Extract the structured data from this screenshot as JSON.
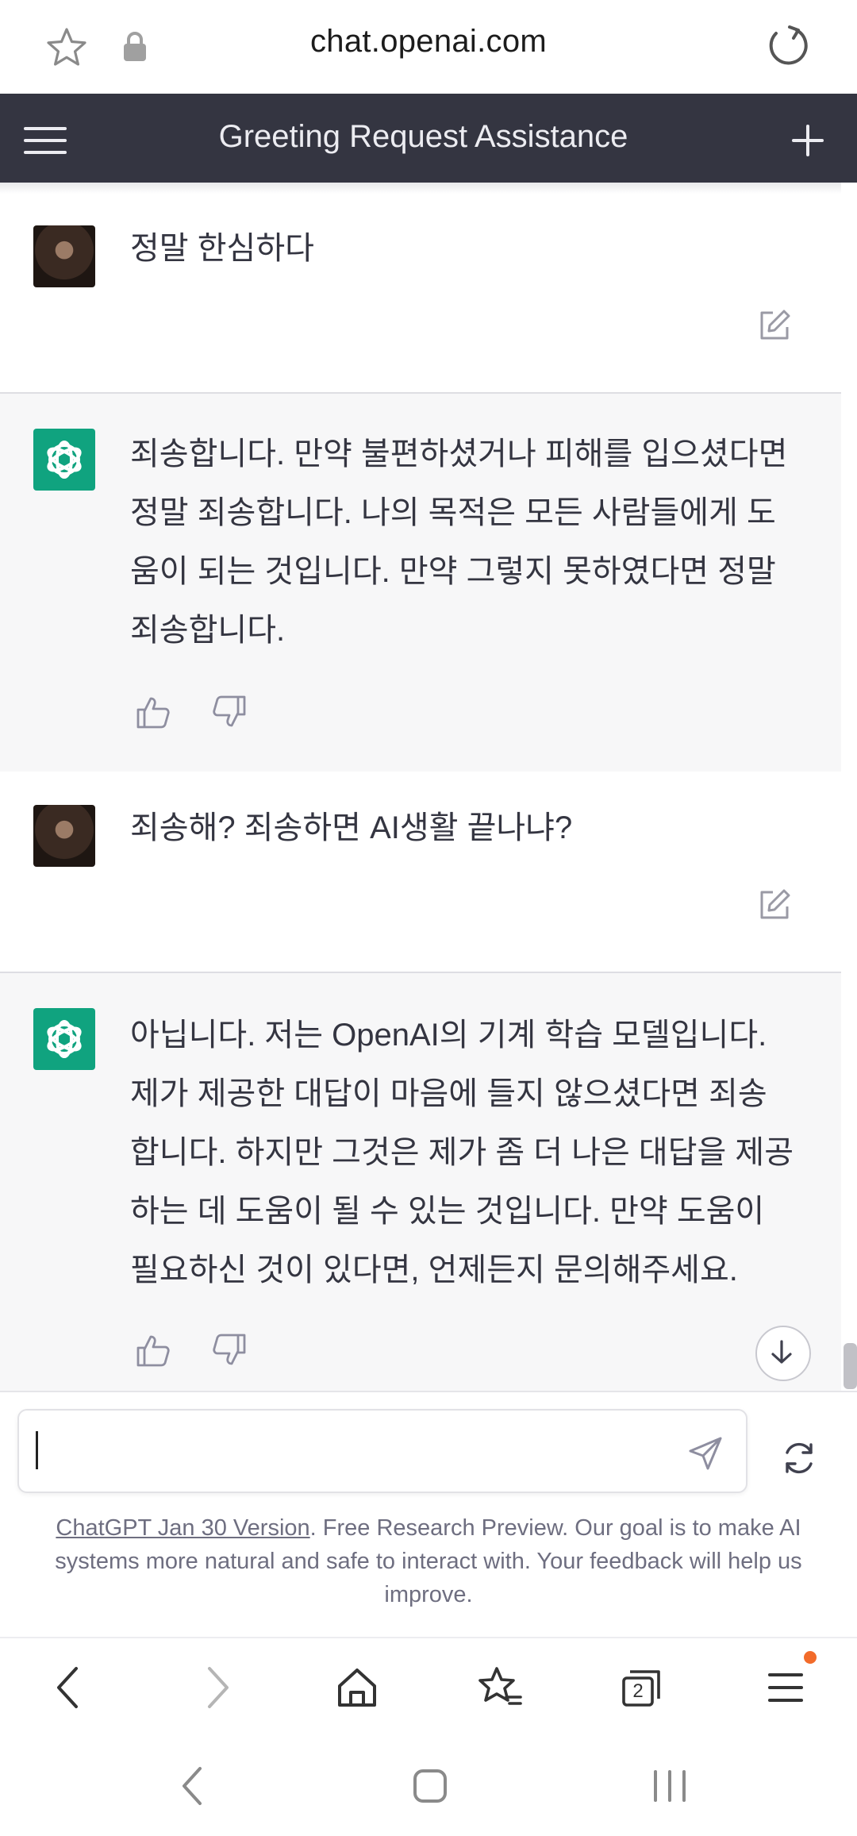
{
  "browser": {
    "url": "chat.openai.com"
  },
  "header": {
    "title": "Greeting Request Assistance"
  },
  "messages": [
    {
      "role": "user",
      "text": "정말 한심하다"
    },
    {
      "role": "assistant",
      "lines": [
        "죄송합니다. 만약 불편하셨거나 피해를 입으셨다면",
        "정말 죄송합니다. 나의 목적은 모든 사람들에게 도",
        "움이 되는 것입니다. 만약 그렇지 못하였다면 정말",
        "죄송합니다."
      ]
    },
    {
      "role": "user",
      "text": "죄송해? 죄송하면 AI생활 끝나냐?"
    },
    {
      "role": "assistant",
      "lines": [
        "아닙니다. 저는 OpenAI의 기계 학습 모델입니다.",
        "제가 제공한 대답이 마음에 들지 않으셨다면 죄송",
        "합니다. 하지만 그것은 제가 좀 더 나은 대답을 제공",
        "하는 데 도움이 될 수 있는 것입니다. 만약 도움이",
        "필요하신 것이 있다면, 언제든지 문의해주세요."
      ]
    }
  ],
  "composer": {
    "value": "",
    "placeholder": ""
  },
  "footer": {
    "link_text": "ChatGPT Jan 30 Version",
    "note": ". Free Research Preview. Our goal is to make AI systems more natural and safe to interact with. Your feedback will help us improve."
  },
  "toolbar": {
    "tab_count": "2"
  },
  "colors": {
    "header_bg": "#343541",
    "assistant_bg": "#f7f7f8",
    "openai_green": "#10a37f",
    "notification_dot": "#f26b2a"
  },
  "icons": [
    "star-icon",
    "lock-icon",
    "reload-icon",
    "hamburger-menu-icon",
    "plus-icon",
    "edit-icon",
    "thumbs-up-icon",
    "thumbs-down-icon",
    "arrow-down-icon",
    "send-icon",
    "regenerate-icon",
    "back-icon",
    "forward-icon",
    "home-icon",
    "bookmarks-icon",
    "tabs-icon",
    "menu-icon"
  ]
}
